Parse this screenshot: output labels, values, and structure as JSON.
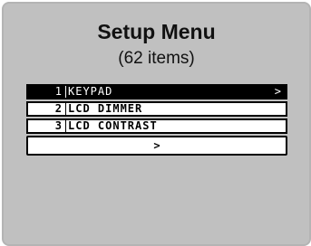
{
  "screen": {
    "title": "Setup Menu",
    "subtitle": "(62 items)"
  },
  "menu": {
    "items": [
      {
        "number": "1",
        "label": "KEYPAD",
        "arrow": ">",
        "selected": true
      },
      {
        "number": "2",
        "label": "LCD DIMMER",
        "arrow": "",
        "selected": false
      },
      {
        "number": "3",
        "label": "LCD CONTRAST",
        "arrow": "",
        "selected": false
      }
    ],
    "more_arrow": ">"
  },
  "colors": {
    "panel_background": "#c0c0c0",
    "selected_row_background": "#000000",
    "row_background": "#ffffff"
  }
}
